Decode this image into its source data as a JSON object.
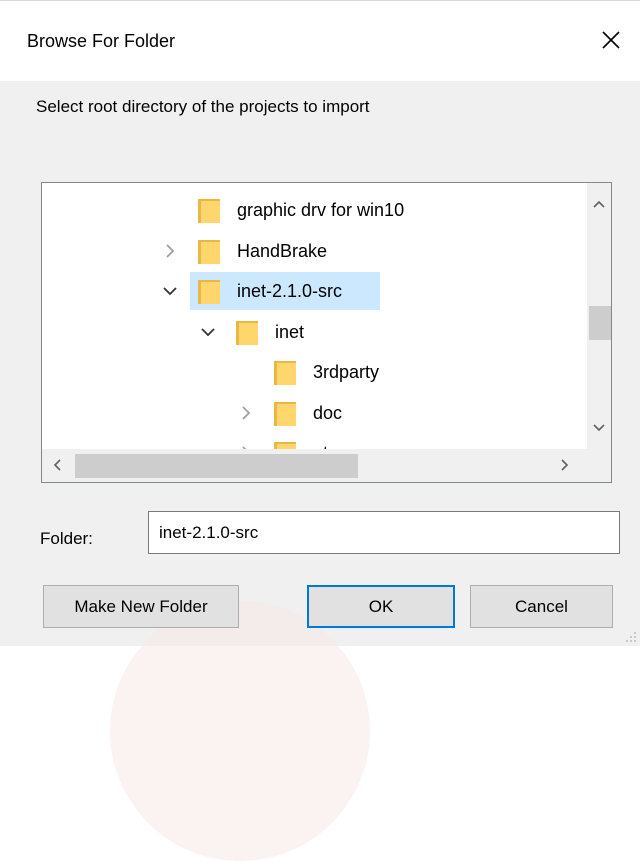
{
  "window": {
    "title": "Browse For Folder",
    "close_icon": "close-icon"
  },
  "instruction": "Select root directory of the projects to import",
  "tree": {
    "items": [
      {
        "label": "graphic drv for win10",
        "level": 0,
        "expander": "none",
        "selected": false
      },
      {
        "label": "HandBrake",
        "level": 0,
        "expander": "collapsed",
        "selected": false
      },
      {
        "label": "inet-2.1.0-src",
        "level": 0,
        "expander": "expanded",
        "selected": true
      },
      {
        "label": "inet",
        "level": 1,
        "expander": "expanded",
        "selected": false
      },
      {
        "label": "3rdparty",
        "level": 2,
        "expander": "none",
        "selected": false
      },
      {
        "label": "doc",
        "level": 2,
        "expander": "collapsed",
        "selected": false
      },
      {
        "label": "etc",
        "level": 2,
        "expander": "collapsed",
        "selected": false
      }
    ]
  },
  "folder": {
    "label": "Folder:",
    "value": "inet-2.1.0-src"
  },
  "buttons": {
    "make_new_folder": "Make New Folder",
    "ok": "OK",
    "cancel": "Cancel"
  },
  "colors": {
    "selection": "#cce8ff",
    "folder_fill": "#ffd66b",
    "accent": "#0078d7"
  }
}
